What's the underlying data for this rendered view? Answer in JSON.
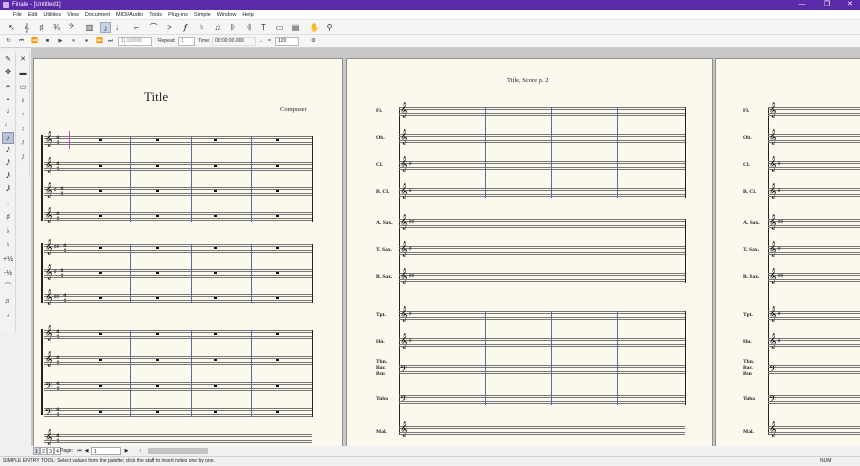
{
  "window": {
    "title": "Finale - [Untitled1]",
    "controls": [
      "—",
      "❐",
      "✕"
    ]
  },
  "menu": [
    "File",
    "Edit",
    "Utilities",
    "View",
    "Document",
    "MIDI/Audio",
    "Tools",
    "Plug-ins",
    "Simple",
    "Window",
    "Help"
  ],
  "toolbar": {
    "icons": [
      "selection-tool",
      "staff-tool",
      "simple-entry-tool",
      "clef-tool",
      "key-signature-tool",
      "time-signature-tool",
      "repeat-tool",
      "measure-tool",
      "note-mover",
      "expression-tool",
      "articulation-tool",
      "tuplet-tool",
      "smart-shape-tool",
      "lyrics-tool",
      "chord-tool",
      "text-tool",
      "resize-tool",
      "page-layout-tool",
      "graphics-tool",
      "hand-grabber",
      "zoom-tool"
    ]
  },
  "playback": {
    "counter": "1| 1|0000",
    "repeat_label": "Repeat:",
    "repeat_value": "1",
    "time_label": "Time:",
    "time_value": "00:00:00.000",
    "tempo_symbol": "=",
    "tempo_value": "120"
  },
  "page1": {
    "title": "Title",
    "composer": "Composer"
  },
  "page2": {
    "header": "Title, Score p. 2",
    "instruments": [
      "Fl.",
      "Ob.",
      "Cl.",
      "B. Cl.",
      "A. Sax.",
      "T. Sax.",
      "B. Sax.",
      "Tpt.",
      "Hn.",
      "Tbn. Bar. Bsn",
      "Tuba",
      "Mal."
    ]
  },
  "page3": {
    "instruments": [
      "Fl.",
      "Ob.",
      "Cl.",
      "B. Cl.",
      "A. Sax.",
      "T. Sax.",
      "B. Sax.",
      "Tpt.",
      "Hn.",
      "Tbn. Bar. Bsn",
      "Tuba",
      "Mal."
    ]
  },
  "nav": {
    "tabs": [
      "1",
      "2",
      "3",
      "4"
    ],
    "page_label": "Page:",
    "page_value": "1"
  },
  "status": {
    "text": "SIMPLE ENTRY TOOL: Select values from the palette; click the staff to insert notes one by one.",
    "num": "NUM"
  }
}
